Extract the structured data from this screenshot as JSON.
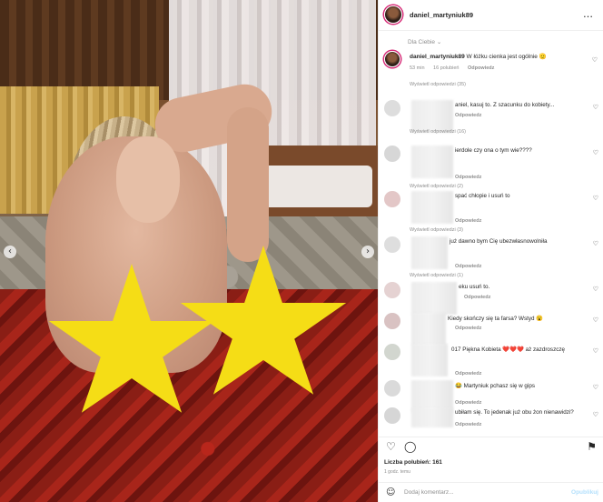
{
  "header": {
    "username": "daniel_martyniuk89",
    "more_icon": "more-icon"
  },
  "sort_label": "Dla Ciebie",
  "caption": {
    "username": "daniel_martyniuk89",
    "text": "W łóżku cienka jest ogólnie 🫡",
    "time": "53 min",
    "likes": "16 polubień",
    "reply": "Odpowiedz",
    "view_replies": "Wyświetl odpowiedzi (35)"
  },
  "comments": [
    {
      "text": "aniel, kasuj to. Z szacunku do kobiety...",
      "reply": "Odpowiedz",
      "view_replies": "Wyświetl odpowiedzi (16)"
    },
    {
      "text": "ierdole czy ona o tym wie????",
      "reply": "Odpowiedz",
      "view_replies": "Wyświetl odpowiedzi (2)"
    },
    {
      "text": "spać chłopie i usuń to",
      "reply": "Odpowiedz",
      "view_replies": "Wyświetl odpowiedzi (3)"
    },
    {
      "text": "już dawno bym Cię ubezwłasnowolniła",
      "reply": "Odpowiedz",
      "view_replies": "Wyświetl odpowiedzi (1)"
    },
    {
      "text": "eku usuń to.",
      "reply": "Odpowiedz",
      "view_replies": ""
    },
    {
      "text": "Kiedy skończy się ta farsa? Wstyd 😮",
      "reply": "Odpowiedz",
      "view_replies": ""
    },
    {
      "text": "017 Piękna Kobieta ❤️❤️❤️ aż zazdroszczę",
      "reply": "Odpowiedz",
      "view_replies": ""
    },
    {
      "text": "😂 Martyniuk pchasz się w gips",
      "reply": "Odpowiedz",
      "view_replies": ""
    },
    {
      "text": "ubiłam się. To jedenak już obu żon nienawidzi?",
      "reply": "Odpowiedz",
      "view_replies": ""
    }
  ],
  "likes_count": "Liczba polubień: 161",
  "posted_ago": "1 godz. temu",
  "comment_input": {
    "placeholder": "Dodaj komentarz...",
    "post_label": "Opublikuj"
  },
  "colors": {
    "accent": "#0095f6",
    "star": "#f5dd16",
    "muted": "#8e8e8e"
  }
}
